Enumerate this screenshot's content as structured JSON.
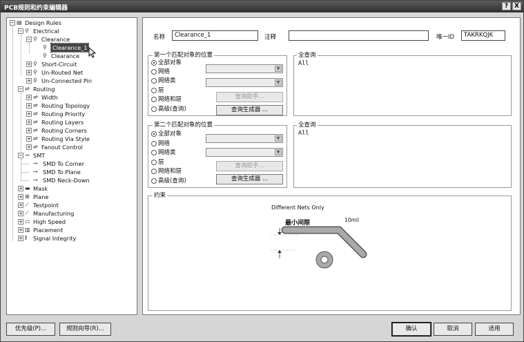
{
  "window": {
    "title": "PCB规则和约束编辑器",
    "help_label": "?",
    "close_label": "X"
  },
  "tree": {
    "root": "Design Rules",
    "electrical": "Electrical",
    "clearance": "Clearance",
    "clearance_1": "Clearance_1",
    "clearance_2": "Clearance",
    "short_circuit": "Short-Circuit",
    "unrouted_net": "Un-Routed Net",
    "unconnected_pin": "Un-Connected Pin",
    "routing": "Routing",
    "width": "Width",
    "routing_topology": "Routing Topology",
    "routing_priority": "Routing Priority",
    "routing_layers": "Routing Layers",
    "routing_corners": "Routing Corners",
    "routing_via_style": "Routing Via Style",
    "fanout_control": "Fanout Control",
    "smt": "SMT",
    "smd_to_corner": "SMD To Corner",
    "smd_to_plane": "SMD To Plane",
    "smd_neck_down": "SMD Neck-Down",
    "mask": "Mask",
    "plane": "Plane",
    "testpoint": "Testpoint",
    "manufacturing": "Manufacturing",
    "high_speed": "High Speed",
    "placement": "Placement",
    "signal_integrity": "Signal Integrity",
    "expand_plus": "+",
    "expand_minus": "−"
  },
  "form": {
    "name_label": "名称",
    "name_value": "Clearance_1",
    "comment_label": "注释",
    "comment_value": "",
    "uid_label": "唯一ID",
    "uid_value": "TAKRKQJK"
  },
  "first_match": {
    "title": "第一个匹配对象的位置",
    "options": [
      "全部对象",
      "网络",
      "网络类",
      "层",
      "网络和层",
      "高级(查询)"
    ],
    "selected": "全部对象",
    "query_helper": "查询助手...",
    "query_builder": "查询生成器 ...",
    "full_query_title": "全查询",
    "full_query_text": "All"
  },
  "second_match": {
    "title": "第二个匹配对象的位置",
    "options": [
      "全部对象",
      "网络",
      "网络类",
      "层",
      "网络和层",
      "高级(查询)"
    ],
    "selected": "全部对象",
    "query_helper": "查询助手...",
    "query_builder": "查询生成器 ...",
    "full_query_title": "全查询",
    "full_query_text": "All"
  },
  "constraints": {
    "title": "约束",
    "net_scope": "Different Nets Only",
    "min_clearance_label": "最小间隙",
    "min_clearance_value": "10mil"
  },
  "footer": {
    "priority_button": "优先级(P)...",
    "wizard_button": "规则向导(R)...",
    "ok_button": "确认",
    "cancel_button": "取消",
    "apply_button": "适用"
  },
  "icons": {
    "tree_folder": "rule-folder-icon",
    "tree_rule": "rule-icon",
    "combo_arrow": "▼",
    "cursor": "pointer-cursor-icon"
  }
}
